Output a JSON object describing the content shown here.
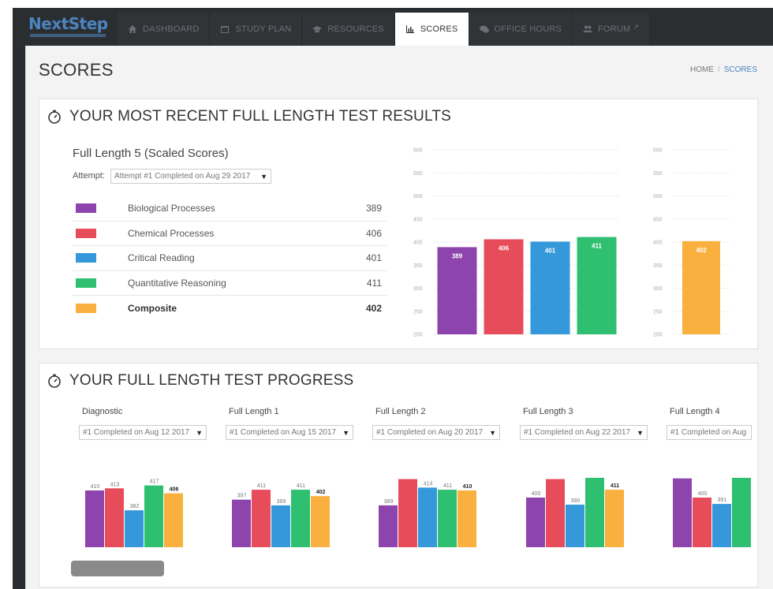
{
  "app": {
    "logo": "NextStep"
  },
  "nav": {
    "tabs": [
      {
        "label": "DASHBOARD",
        "icon": "home-icon"
      },
      {
        "label": "STUDY PLAN",
        "icon": "calendar-icon"
      },
      {
        "label": "RESOURCES",
        "icon": "graduation-cap-icon"
      },
      {
        "label": "SCORES",
        "icon": "bar-chart-icon",
        "active": true
      },
      {
        "label": "OFFICE HOURS",
        "icon": "chat-icon"
      },
      {
        "label": "FORUM",
        "icon": "users-icon",
        "external": true
      }
    ]
  },
  "page": {
    "title": "SCORES"
  },
  "breadcrumb": {
    "home": "HOME",
    "separator": "/",
    "current": "SCORES"
  },
  "recent": {
    "title": "YOUR MOST RECENT FULL LENGTH TEST RESULTS",
    "subtitle": "Full Length 5 (Scaled Scores)",
    "attempt_label": "Attempt:",
    "attempt_value": "Attempt #1 Completed on Aug 29 2017",
    "rows": [
      {
        "name": "Biological Processes",
        "value": "389",
        "color": "#8e44ad"
      },
      {
        "name": "Chemical Processes",
        "value": "406",
        "color": "#e74c5a"
      },
      {
        "name": "Critical Reading",
        "value": "401",
        "color": "#3498db"
      },
      {
        "name": "Quantitative Reasoning",
        "value": "411",
        "color": "#2fbf71"
      },
      {
        "name": "Composite",
        "value": "402",
        "color": "#f9b03e",
        "bold": true
      }
    ]
  },
  "chart_data": [
    {
      "type": "bar",
      "categories": [
        "Biological Processes",
        "Chemical Processes",
        "Critical Reading",
        "Quantitative Reasoning"
      ],
      "values": [
        389,
        406,
        401,
        411
      ],
      "colors": [
        "#8e44ad",
        "#e74c5a",
        "#3498db",
        "#2fbf71"
      ],
      "ylim": [
        200,
        600
      ],
      "yticks": [
        200,
        250,
        300,
        350,
        400,
        450,
        500,
        550,
        600
      ],
      "grid": true
    },
    {
      "type": "bar",
      "categories": [
        "Composite"
      ],
      "values": [
        402
      ],
      "colors": [
        "#f9b03e"
      ],
      "ylim": [
        200,
        600
      ],
      "yticks": [
        200,
        250,
        300,
        350,
        400,
        450,
        500,
        550,
        600
      ],
      "grid": true
    }
  ],
  "progress": {
    "title": "YOUR FULL LENGTH TEST PROGRESS",
    "colors": [
      "#8e44ad",
      "#e74c5a",
      "#3498db",
      "#2fbf71",
      "#f9b03e"
    ],
    "tests": [
      {
        "name": "Diagnostic",
        "attempt": "#1 Completed on Aug 12 2017",
        "values": [
          410,
          413,
          382,
          417,
          406
        ]
      },
      {
        "name": "Full Length 1",
        "attempt": "#1 Completed on Aug 15 2017",
        "values": [
          397,
          411,
          389,
          411,
          402
        ]
      },
      {
        "name": "Full Length 2",
        "attempt": "#1 Completed on Aug 20 2017",
        "values": [
          389,
          426,
          414,
          411,
          410
        ]
      },
      {
        "name": "Full Length 3",
        "attempt": "#1 Completed on Aug 22 2017",
        "values": [
          400,
          426,
          390,
          428,
          411
        ]
      },
      {
        "name": "Full Length 4",
        "attempt": "#1 Completed on Aug",
        "values": [
          427,
          400,
          391,
          429
        ]
      }
    ]
  }
}
